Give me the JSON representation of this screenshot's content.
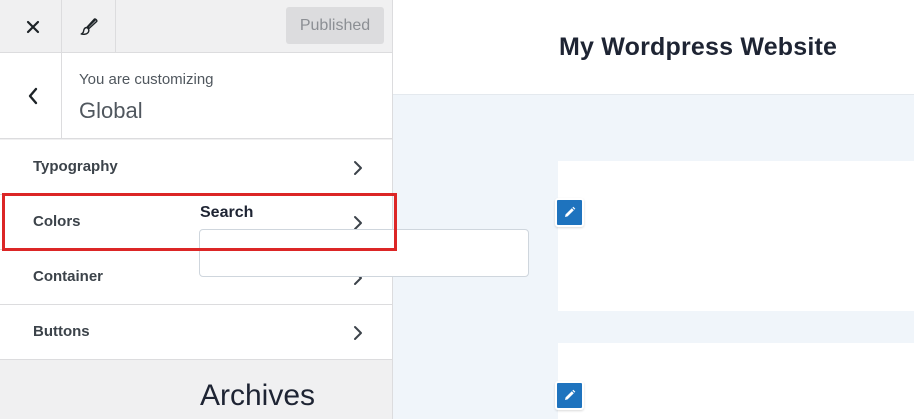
{
  "toolbar": {
    "close_icon": "close-icon",
    "brush_icon": "paintbrush-icon",
    "publish_label": "Published"
  },
  "section": {
    "back_icon": "chevron-left-icon",
    "customizing_label": "You are customizing",
    "title": "Global"
  },
  "menu": {
    "items": [
      {
        "label": "Typography",
        "icon": "chevron-right-icon"
      },
      {
        "label": "Colors",
        "icon": "chevron-right-icon",
        "highlighted": true
      },
      {
        "label": "Container",
        "icon": "chevron-right-icon"
      },
      {
        "label": "Buttons",
        "icon": "chevron-right-icon"
      }
    ]
  },
  "preview": {
    "site_title": "My Wordpress Website",
    "widgets": {
      "search": {
        "label": "Search",
        "input_value": "",
        "edit_icon": "pencil-icon"
      },
      "archives": {
        "title": "Archives",
        "edit_icon": "pencil-icon"
      }
    }
  },
  "colors": {
    "highlight": "#dc2626",
    "edit_shortcut": "#1e73be",
    "preview_background": "#f0f5fa"
  }
}
